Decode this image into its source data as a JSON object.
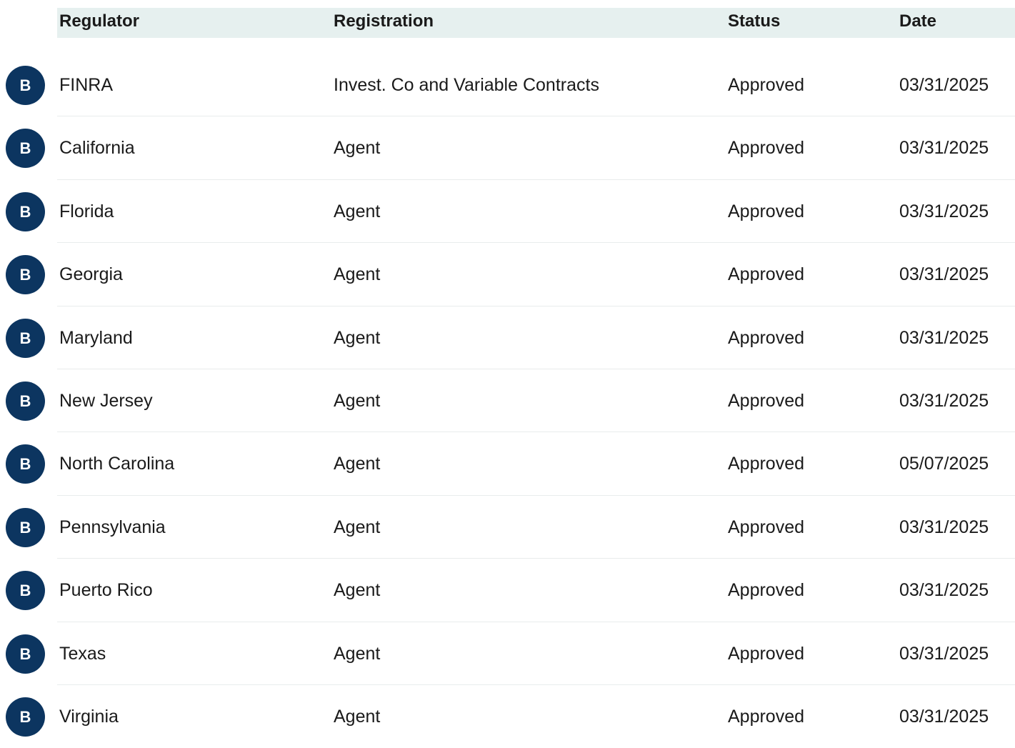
{
  "table": {
    "headers": {
      "regulator": "Regulator",
      "registration": "Registration",
      "status": "Status",
      "date": "Date"
    },
    "badge_color": "#0c3560",
    "header_bg": "#e6f0ef",
    "rows": [
      {
        "badge": "B",
        "regulator": "FINRA",
        "registration": "Invest. Co and Variable Contracts",
        "status": "Approved",
        "date": "03/31/2025"
      },
      {
        "badge": "B",
        "regulator": "California",
        "registration": "Agent",
        "status": "Approved",
        "date": "03/31/2025"
      },
      {
        "badge": "B",
        "regulator": "Florida",
        "registration": "Agent",
        "status": "Approved",
        "date": "03/31/2025"
      },
      {
        "badge": "B",
        "regulator": "Georgia",
        "registration": "Agent",
        "status": "Approved",
        "date": "03/31/2025"
      },
      {
        "badge": "B",
        "regulator": "Maryland",
        "registration": "Agent",
        "status": "Approved",
        "date": "03/31/2025"
      },
      {
        "badge": "B",
        "regulator": "New Jersey",
        "registration": "Agent",
        "status": "Approved",
        "date": "03/31/2025"
      },
      {
        "badge": "B",
        "regulator": "North Carolina",
        "registration": "Agent",
        "status": "Approved",
        "date": "05/07/2025"
      },
      {
        "badge": "B",
        "regulator": "Pennsylvania",
        "registration": "Agent",
        "status": "Approved",
        "date": "03/31/2025"
      },
      {
        "badge": "B",
        "regulator": "Puerto Rico",
        "registration": "Agent",
        "status": "Approved",
        "date": "03/31/2025"
      },
      {
        "badge": "B",
        "regulator": "Texas",
        "registration": "Agent",
        "status": "Approved",
        "date": "03/31/2025"
      },
      {
        "badge": "B",
        "regulator": "Virginia",
        "registration": "Agent",
        "status": "Approved",
        "date": "03/31/2025"
      }
    ]
  }
}
